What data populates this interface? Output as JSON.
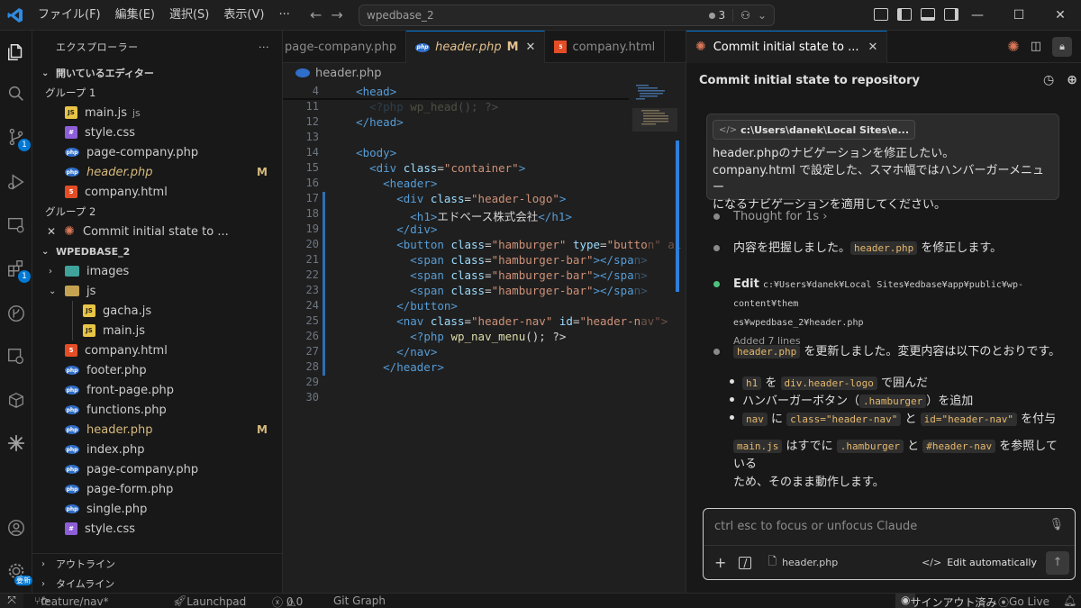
{
  "titlebar": {
    "menus": [
      "ファイル(F)",
      "編集(E)",
      "選択(S)",
      "表示(V)"
    ],
    "more": "···",
    "search_text": "wpedbase_2",
    "notification_count": "3"
  },
  "activity": {
    "scm_badge": "1",
    "ext_badge": "1",
    "account_badge": "要新"
  },
  "sidebar": {
    "title": "エクスプローラー",
    "more": "···",
    "open_editors_title": "開いているエディター",
    "group1_label": "グループ 1",
    "group1_files": [
      {
        "name": "main.js",
        "suffix": "js",
        "type": "js"
      },
      {
        "name": "style.css",
        "suffix": "",
        "type": "css"
      },
      {
        "name": "page-company.php",
        "suffix": "",
        "type": "php"
      },
      {
        "name": "header.php",
        "suffix": "",
        "type": "php",
        "modified": "M"
      },
      {
        "name": "company.html",
        "suffix": "",
        "type": "html"
      }
    ],
    "group2_label": "グループ 2",
    "group2_files": [
      {
        "name": "Commit initial state to ...",
        "type": "claude"
      }
    ],
    "workspace_title": "WPEDBASE_2",
    "tree": [
      {
        "name": "images",
        "kind": "folderimg",
        "depth": 0,
        "twist": "›"
      },
      {
        "name": "js",
        "kind": "folder",
        "depth": 0,
        "twist": "⌄"
      },
      {
        "name": "gacha.js",
        "kind": "js",
        "depth": 1
      },
      {
        "name": "main.js",
        "kind": "js",
        "depth": 1
      },
      {
        "name": "company.html",
        "kind": "html",
        "depth": 0
      },
      {
        "name": "footer.php",
        "kind": "php",
        "depth": 0
      },
      {
        "name": "front-page.php",
        "kind": "php",
        "depth": 0
      },
      {
        "name": "functions.php",
        "kind": "php",
        "depth": 0
      },
      {
        "name": "header.php",
        "kind": "php",
        "depth": 0,
        "modified": "M"
      },
      {
        "name": "index.php",
        "kind": "php",
        "depth": 0
      },
      {
        "name": "page-company.php",
        "kind": "php",
        "depth": 0
      },
      {
        "name": "page-form.php",
        "kind": "php",
        "depth": 0
      },
      {
        "name": "single.php",
        "kind": "php",
        "depth": 0
      },
      {
        "name": "style.css",
        "kind": "css",
        "depth": 0
      }
    ],
    "outline_title": "アウトライン",
    "timeline_title": "タイムライン"
  },
  "editor": {
    "tabs": [
      {
        "label": "page-company.php",
        "icon": "php",
        "active": false
      },
      {
        "label": "header.php",
        "icon": "php",
        "active": true,
        "modified": "M"
      },
      {
        "label": "company.html",
        "icon": "html",
        "active": false
      }
    ],
    "breadcrumb": "header.php",
    "lines": [
      {
        "n": "4",
        "html": "  <span class='t'>&lt;head&gt;</span>"
      },
      {
        "n": "11",
        "html": "    <span class='t dim'>&lt;?php</span> <span class='f dim'>wp_head</span><span class='dim'>(); ?&gt;</span>"
      },
      {
        "n": "12",
        "html": "  <span class='t'>&lt;/head&gt;</span>"
      },
      {
        "n": "13",
        "html": ""
      },
      {
        "n": "14",
        "html": "  <span class='t'>&lt;body&gt;</span>"
      },
      {
        "n": "15",
        "html": "    <span class='t'>&lt;div</span> <span class='a'>class</span>=<span class='s'>\"container\"</span><span class='t'>&gt;</span>"
      },
      {
        "n": "16",
        "html": "      <span class='t'>&lt;header&gt;</span>"
      },
      {
        "n": "17",
        "html": "        <span class='t'>&lt;div</span> <span class='a'>class</span>=<span class='s'>\"header-logo\"</span><span class='t'>&gt;</span>"
      },
      {
        "n": "18",
        "html": "          <span class='t'>&lt;h1&gt;</span><span class='w'>エドベース株式会社</span><span class='t'>&lt;/h1&gt;</span>"
      },
      {
        "n": "19",
        "html": "        <span class='t'>&lt;/div&gt;</span>"
      },
      {
        "n": "20",
        "html": "        <span class='t'>&lt;button</span> <span class='a'>class</span>=<span class='s'>\"hamburger\"</span> <span class='a'>type</span>=<span class='s'>\"butto</span><span class='s dim'>n\" ai</span>"
      },
      {
        "n": "21",
        "html": "          <span class='t'>&lt;span</span> <span class='a'>class</span>=<span class='s'>\"hamburger-bar\"</span><span class='t'>&gt;&lt;/spa</span><span class='t dim'>n&gt;</span>"
      },
      {
        "n": "22",
        "html": "          <span class='t'>&lt;span</span> <span class='a'>class</span>=<span class='s'>\"hamburger-bar\"</span><span class='t'>&gt;&lt;/spa</span><span class='t dim'>n&gt;</span>"
      },
      {
        "n": "23",
        "html": "          <span class='t'>&lt;span</span> <span class='a'>class</span>=<span class='s'>\"hamburger-bar\"</span><span class='t'>&gt;&lt;/spa</span><span class='t dim'>n&gt;</span>"
      },
      {
        "n": "24",
        "html": "        <span class='t'>&lt;/button&gt;</span>"
      },
      {
        "n": "25",
        "html": "        <span class='t'>&lt;nav</span> <span class='a'>class</span>=<span class='s'>\"header-nav\"</span> <span class='a'>id</span>=<span class='s'>\"header-n</span><span class='s dim'>av\"&gt;</span>"
      },
      {
        "n": "26",
        "html": "          <span class='t'>&lt;?php</span> <span class='f'>wp_nav_menu</span><span class='w'>(); ?&gt;</span>"
      },
      {
        "n": "27",
        "html": "        <span class='t'>&lt;/nav&gt;</span>"
      },
      {
        "n": "28",
        "html": "      <span class='t'>&lt;/header&gt;</span>"
      },
      {
        "n": "29",
        "html": ""
      },
      {
        "n": "30",
        "html": ""
      }
    ]
  },
  "chat": {
    "tab_title": "Commit initial state to ...",
    "header_title": "Commit initial state to repository",
    "user_context_chip": "c:\\Users\\danek\\Local Sites\\e...",
    "user_message_line1": "header.phpのナビゲーションを修正したい。",
    "user_message_line2": "company.html で設定した、スマホ幅ではハンバーガーメニュー",
    "user_message_line3": "になるナビゲーションを適用してください。",
    "thought": "Thought for 1s",
    "msg1_pre": "内容を把握しました。",
    "msg1_chip": "header.php",
    "msg1_post": " を修正します。",
    "edit_label": "Edit",
    "edit_path_1": "c:¥Users¥danek¥Local Sites¥edbase¥app¥public¥wp-content¥them",
    "edit_path_2": "es¥wpedbase_2¥header.php",
    "edit_summary": "Added 7 lines",
    "msg2_chip": "header.php",
    "msg2_post": " を更新しました。変更内容は以下のとおりです。",
    "b1_c1": "h1",
    "b1_t1": " を ",
    "b1_c2": "div.header-logo",
    "b1_t2": " で囲んだ",
    "b2_t1": "ハンバーガーボタン（",
    "b2_c1": ".hamburger",
    "b2_t2": "）を追加",
    "b3_c1": "nav",
    "b3_t1": " に ",
    "b3_c2": "class=\"header-nav\"",
    "b3_t2": " と ",
    "b3_c3": "id=\"header-nav\"",
    "b3_t3": " を付与",
    "msg3_c1": "main.js",
    "msg3_t1": " はすでに ",
    "msg3_c2": ".hamburger",
    "msg3_t2": " と ",
    "msg3_c3": "#header-nav",
    "msg3_t3": " を参照している",
    "msg3_line2": "ため、そのまま動作します。",
    "input_placeholder": "ctrl esc to focus or unfocus Claude",
    "input_file": "header.php",
    "input_mode": "Edit automatically"
  },
  "status": {
    "branch": "feature/nav*",
    "launchpad": "Launchpad",
    "errors": "0",
    "warnings": "0",
    "gitgraph": "Git Graph",
    "signin": "サインアウト済み",
    "golive": "Go Live"
  }
}
